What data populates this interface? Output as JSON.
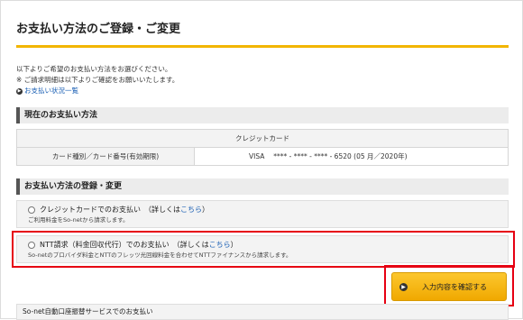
{
  "page_title": "お支払い方法のご登録・ご変更",
  "intro": {
    "line1": "以下よりご希望のお支払い方法をお選びください。",
    "line2": "※ ご請求明細は以下よりご確認をお願いいたします。",
    "status_link": "お支払い状況一覧"
  },
  "current_section": {
    "title": "現在のお支払い方法",
    "table_header": "クレジットカード",
    "row_label": "カード種別／カード番号(有効期限)",
    "row_value": "VISA　 ****  - ****  - ****  - 6520  (05 月／2020年)"
  },
  "register_section": {
    "title": "お支払い方法の登録・変更",
    "options": [
      {
        "label": "クレジットカードでのお支払い　（詳しくは",
        "link": "こちら",
        "close": "）",
        "sub": "ご利用料金をSo-netから請求します。"
      },
      {
        "label": "NTT請求（料金回収代行）でのお支払い　（詳しくは",
        "link": "こちら",
        "close": "）",
        "sub": "So-netのプロバイダ料金とNTTのフレッツ光回線料金を合わせてNTTファイナンスから請求します。"
      }
    ]
  },
  "confirm_button": "入力内容を確認する",
  "bottom_option": "So-net自動口座振替サービスでのお支払い",
  "colors": {
    "accent": "#f2b500",
    "highlight": "#e60012",
    "link": "#1a5fb4"
  }
}
